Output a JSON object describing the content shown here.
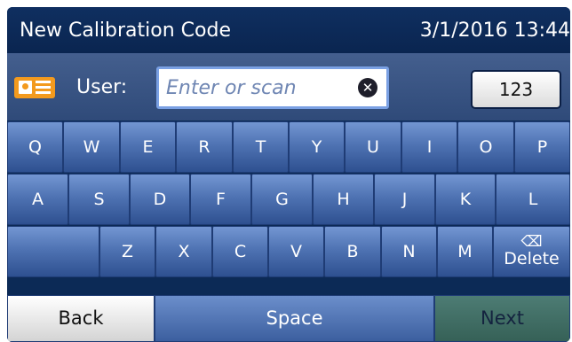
{
  "header": {
    "title": "New Calibration Code",
    "datetime": "3/1/2016 13:44"
  },
  "user_row": {
    "icon": "id-card-icon",
    "label": "User:",
    "input_value": "",
    "input_placeholder": "Enter or scan",
    "clear_icon": "clear-x-icon",
    "numeric_toggle_label": "123"
  },
  "keyboard": {
    "row1": [
      "Q",
      "W",
      "E",
      "R",
      "T",
      "Y",
      "U",
      "I",
      "O",
      "P"
    ],
    "row2": [
      "A",
      "S",
      "D",
      "F",
      "G",
      "H",
      "J",
      "K",
      "L"
    ],
    "row3": [
      "Z",
      "X",
      "C",
      "V",
      "B",
      "N",
      "M"
    ],
    "delete_icon": "backspace-icon",
    "delete_label": "Delete"
  },
  "footer": {
    "back_label": "Back",
    "space_label": "Space",
    "next_label": "Next"
  },
  "colors": {
    "title_bar": "#0a2550",
    "key_blue": "#4f73b3",
    "id_icon": "#f39a1e",
    "next_button": "#366157"
  }
}
